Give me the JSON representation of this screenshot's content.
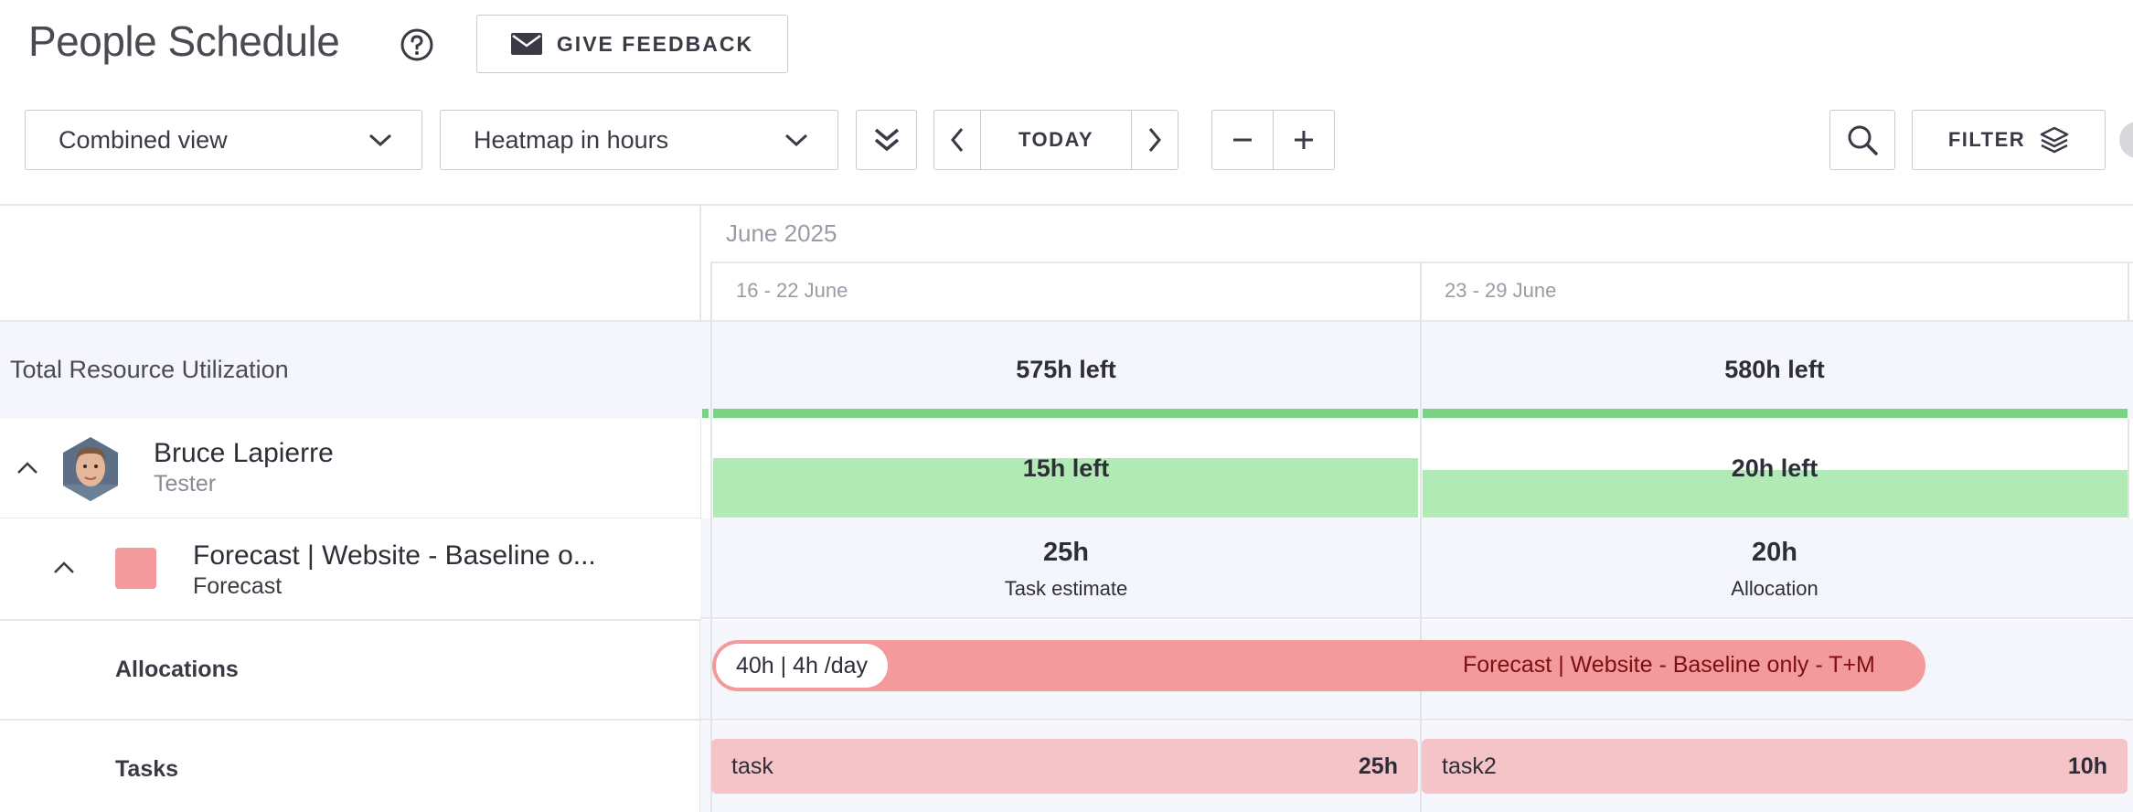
{
  "header": {
    "title": "People Schedule",
    "feedback_label": "GIVE FEEDBACK"
  },
  "toolbar": {
    "view_select": "Combined view",
    "heatmap_select": "Heatmap in hours",
    "today_label": "TODAY",
    "filter_label": "FILTER"
  },
  "calendar": {
    "month": "June 2025",
    "weeks": [
      "16 - 22 June",
      "23 - 29 June"
    ]
  },
  "total": {
    "label": "Total Resource Utilization",
    "values": [
      "575h left",
      "580h left"
    ]
  },
  "person": {
    "name": "Bruce Lapierre",
    "role": "Tester",
    "values": [
      "15h left",
      "20h left"
    ],
    "utilization_fraction": [
      0.6,
      0.48
    ]
  },
  "project": {
    "name": "Forecast | Website - Baseline o...",
    "client": "Forecast",
    "values": [
      {
        "num": "25h",
        "caption": "Task estimate"
      },
      {
        "num": "20h",
        "caption": "Allocation"
      }
    ]
  },
  "allocations": {
    "label": "Allocations",
    "pill": "40h | 4h /day",
    "bar_label": "Forecast | Website - Baseline only - T+M"
  },
  "tasks": {
    "label": "Tasks",
    "items": [
      {
        "name": "task",
        "hours": "25h"
      },
      {
        "name": "task2",
        "hours": "10h"
      }
    ]
  },
  "colors": {
    "project": "#f29a9c",
    "heat_green": "#b1eab4",
    "total_green": "#7cd284",
    "task": "#f4c4c8"
  }
}
